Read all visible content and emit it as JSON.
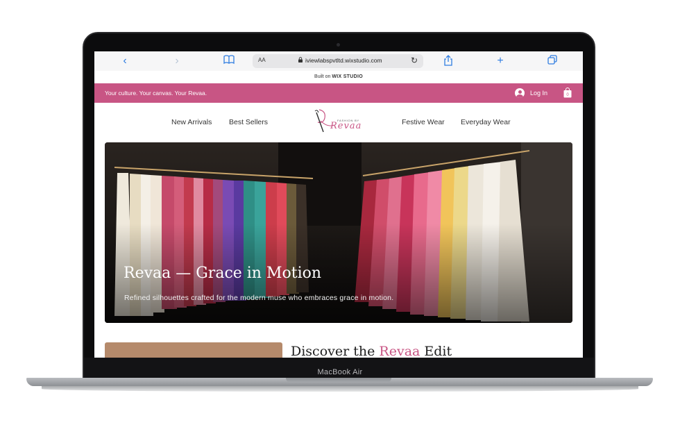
{
  "device": {
    "model_label": "MacBook Air"
  },
  "browser": {
    "aa_label": "AA",
    "url": "iviewlabspvtltd.wixstudio.com"
  },
  "built_on": {
    "prefix": "Built on",
    "brand": "WIX STUDIO"
  },
  "promo_bar": {
    "text": "Your culture. Your canvas. Your Revaa.",
    "login_label": "Log In",
    "cart_count": "0",
    "color": "#c85584"
  },
  "nav": {
    "left": [
      "New Arrivals",
      "Best Sellers"
    ],
    "right": [
      "Festive Wear",
      "Everyday Wear"
    ],
    "logo_small": "FASHION BY",
    "logo_script": "Revaa"
  },
  "hero": {
    "title": "Revaa — Grace in Motion",
    "subtitle": "Refined silhouettes crafted for the modern muse who embraces grace in motion."
  },
  "discover": {
    "before": "Discover the ",
    "accent": "Revaa",
    "after": " Edit"
  }
}
